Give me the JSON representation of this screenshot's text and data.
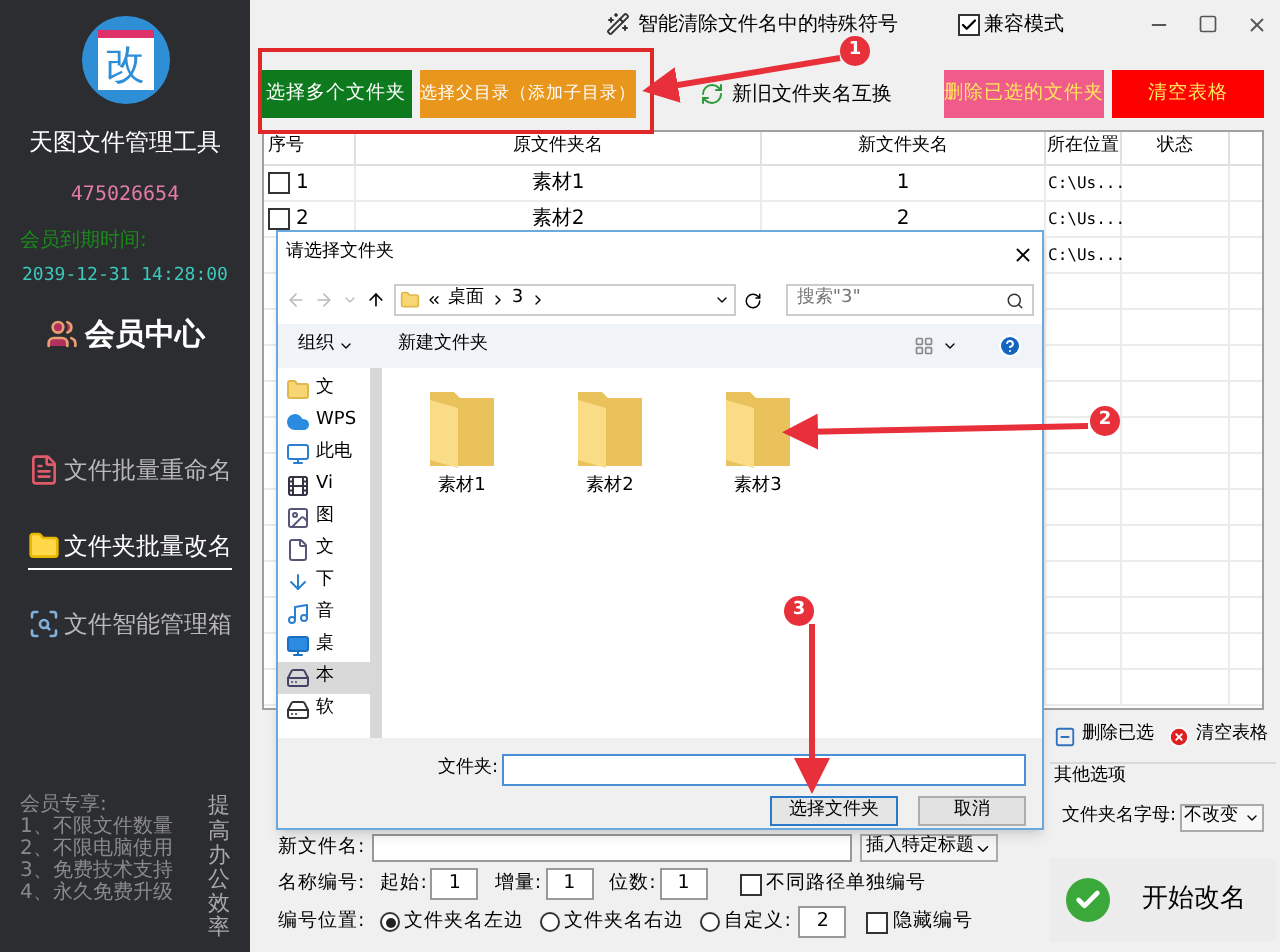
{
  "sidebar": {
    "logo_text": "改",
    "app_name": "天图文件管理工具",
    "user_id": "475026654",
    "expiry_label": "会员到期时间:",
    "expiry_date": "2039-12-31 14:28:00",
    "member_center": "会员中心",
    "nav": [
      {
        "label": "文件批量重命名",
        "kind": "file",
        "selected": false
      },
      {
        "label": "文件夹批量改名",
        "kind": "folder",
        "selected": true
      },
      {
        "label": "文件智能管理箱",
        "kind": "box",
        "selected": false
      }
    ],
    "perks": [
      "会员专享:",
      "1、不限文件数量",
      "2、不限电脑使用",
      "3、免费技术支持",
      "4、永久免费升级"
    ],
    "slogan": "提高办公效率"
  },
  "header": {
    "title": "智能清除文件名中的特殊符号",
    "compat": {
      "label": "兼容模式",
      "checked": true
    }
  },
  "left_buttons": [
    {
      "label": "选择多个文件夹",
      "color": "#0e7a1e"
    },
    {
      "label": "选择父目录（添加子目录）",
      "color": "#e8971c"
    }
  ],
  "swap_button": "新旧文件夹名互换",
  "right_buttons": [
    {
      "label": "删除已选的文件夹",
      "color": "#ef5b8a"
    },
    {
      "label": "清空表格",
      "color": "#ff0000"
    }
  ],
  "table": {
    "columns": [
      "序号",
      "原文件夹名",
      "新文件夹名",
      "所在位置",
      "状态"
    ],
    "rows": [
      {
        "index": "1",
        "checked": false,
        "old": "素材1",
        "new": "1",
        "location": "C:\\Us..."
      },
      {
        "index": "2",
        "checked": false,
        "old": "素材2",
        "new": "2",
        "location": "C:\\Us..."
      },
      {
        "location": "C:\\Us..."
      }
    ]
  },
  "dialog": {
    "title": "请选择文件夹",
    "crumbs": [
      "桌面",
      "3"
    ],
    "search_placeholder": "搜索\"3\"",
    "organize": "组织",
    "new_folder": "新建文件夹",
    "tree": [
      {
        "label": "文",
        "kind": "folder",
        "selected": false
      },
      {
        "label": "WPS",
        "kind": "cloud",
        "selected": false
      },
      {
        "label": "此电",
        "kind": "pc",
        "selected": false
      },
      {
        "label": "Vi",
        "kind": "video",
        "selected": false
      },
      {
        "label": "图",
        "kind": "picture",
        "selected": false
      },
      {
        "label": "文",
        "kind": "doc",
        "selected": false
      },
      {
        "label": "下",
        "kind": "download",
        "selected": false
      },
      {
        "label": "音",
        "kind": "music",
        "selected": false
      },
      {
        "label": "桌",
        "kind": "desktop",
        "selected": false
      },
      {
        "label": "本",
        "kind": "drive",
        "selected": true
      },
      {
        "label": "软",
        "kind": "disk",
        "selected": false
      }
    ],
    "folders": [
      "素材1",
      "素材2",
      "素材3"
    ],
    "folder_label": "文件夹:",
    "ok": "选择文件夹",
    "cancel": "取消"
  },
  "form": {
    "new_name_label": "新文件名:",
    "insert_select": "插入特定标题",
    "number_label": "名称编号:",
    "start_label": "起始:",
    "start": "1",
    "step_label": "增量:",
    "step": "1",
    "digits_label": "位数:",
    "digits": "1",
    "separate": {
      "label": "不同路径单独编号",
      "checked": false
    },
    "position_label": "编号位置:",
    "positions": [
      {
        "label": "文件夹名左边",
        "selected": true
      },
      {
        "label": "文件夹名右边",
        "selected": false
      },
      {
        "label": "自定义:",
        "selected": false
      }
    ],
    "custom_value": "2",
    "hide": {
      "label": "隐藏编号",
      "checked": false
    }
  },
  "side_panel": {
    "delete_selected": "删除已选",
    "clear": "清空表格",
    "group_title": "其他选项",
    "letter_label": "文件夹名字母:",
    "letter_value": "不改变",
    "start": "开始改名"
  },
  "annotations": [
    "1",
    "2",
    "3"
  ]
}
